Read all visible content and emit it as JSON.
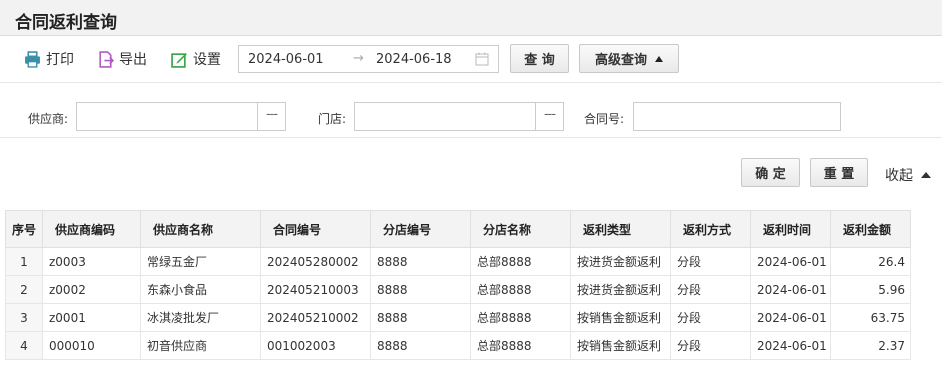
{
  "page": {
    "title": "合同返利查询"
  },
  "toolbar": {
    "print_label": "打印",
    "export_label": "导出",
    "settings_label": "设置",
    "date_start": "2024-06-01",
    "date_separator": "→",
    "date_end": "2024-06-18",
    "query_label": "查 询",
    "advanced_label": "高级查询"
  },
  "filters": {
    "supplier_label": "供应商:",
    "supplier_value": "",
    "store_label": "门店:",
    "store_value": "",
    "contract_label": "合同号:",
    "contract_value": "",
    "picker_label": "---"
  },
  "actions": {
    "confirm_label": "确 定",
    "reset_label": "重 置",
    "collapse_label": "收起"
  },
  "table": {
    "headers": [
      "序号",
      "供应商编码",
      "供应商名称",
      "合同编号",
      "分店编号",
      "分店名称",
      "返利类型",
      "返利方式",
      "返利时间",
      "返利金额"
    ],
    "rows": [
      [
        "1",
        "z0003",
        "常绿五金厂",
        "202405280002",
        "8888",
        "总部8888",
        "按进货金额返利",
        "分段",
        "2024-06-01",
        "26.4"
      ],
      [
        "2",
        "z0002",
        "东森小食品",
        "202405210003",
        "8888",
        "总部8888",
        "按进货金额返利",
        "分段",
        "2024-06-01",
        "5.96"
      ],
      [
        "3",
        "z0001",
        "冰淇凌批发厂",
        "202405210002",
        "8888",
        "总部8888",
        "按销售金额返利",
        "分段",
        "2024-06-01",
        "63.75"
      ],
      [
        "4",
        "000010",
        "初音供应商",
        "001002003",
        "8888",
        "总部8888",
        "按销售金额返利",
        "分段",
        "2024-06-01",
        "2.37"
      ]
    ]
  },
  "icons": {
    "print": "printer-icon",
    "export": "export-file-icon",
    "settings": "edit-settings-icon",
    "calendar": "calendar-icon"
  },
  "colors": {
    "print_icon": "#3a8fa8",
    "export_icon": "#b15cc4",
    "settings_icon": "#3aa64a"
  }
}
